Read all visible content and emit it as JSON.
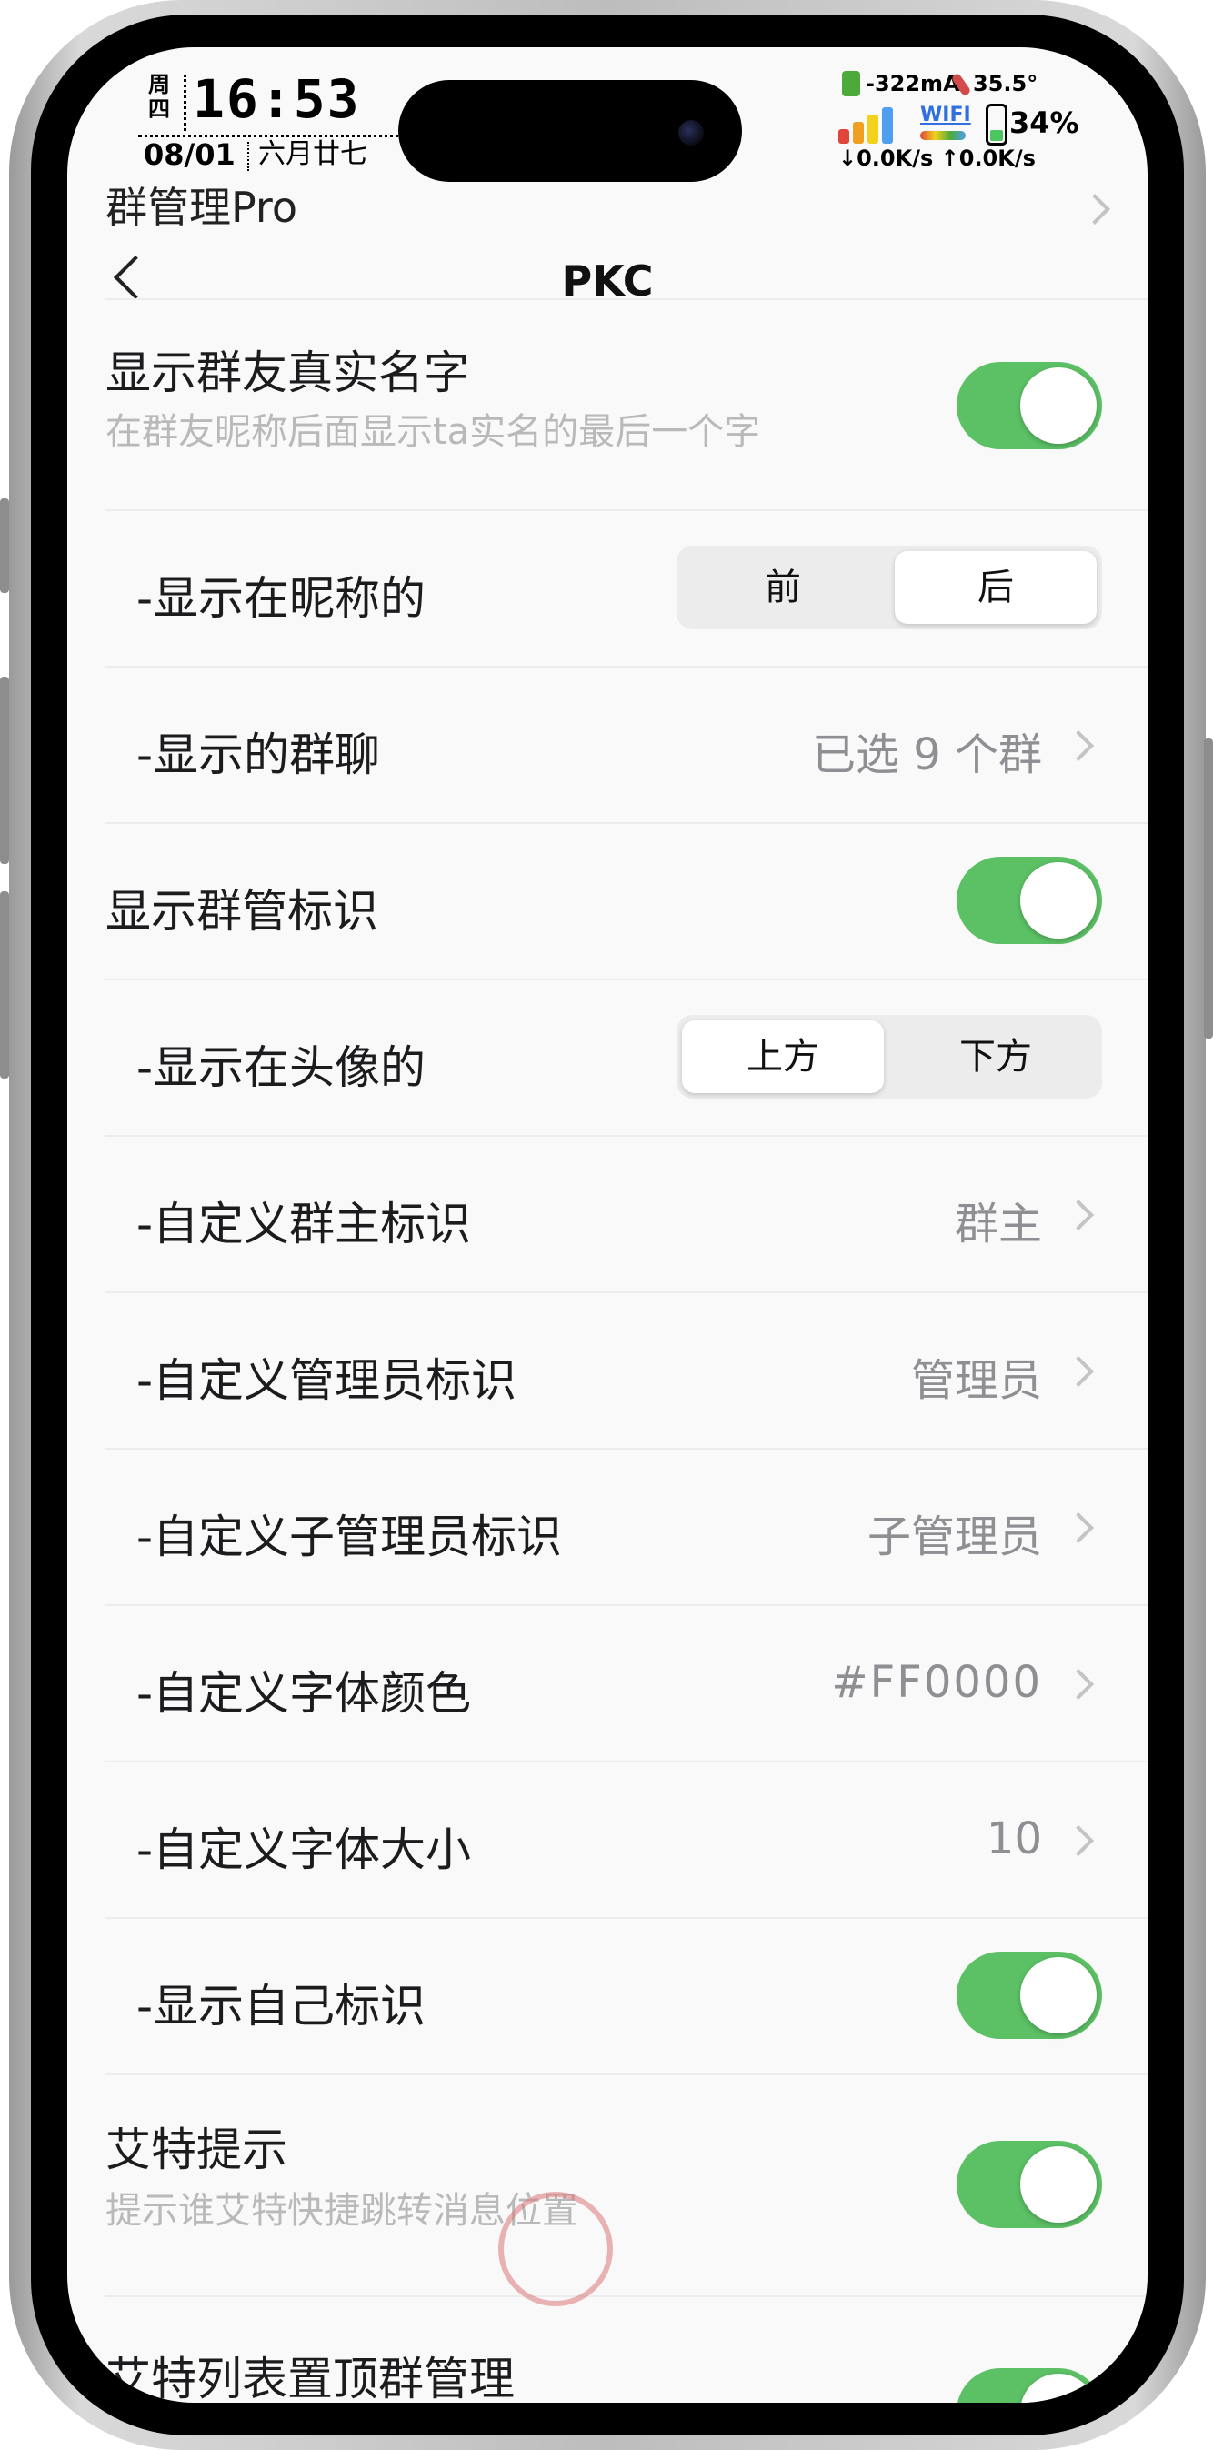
{
  "status_bar": {
    "weekday": "周四",
    "time": "16:53",
    "date": "08/01",
    "lunar_date": "六月廿七",
    "current": "-322mA",
    "temperature": "35.5°",
    "wifi_label": "WIFI",
    "battery": "34%",
    "network_speed": "↓0.0K/s ↑0.0K/s"
  },
  "nav": {
    "partial_title": "群管理Pro",
    "title": "PKC"
  },
  "rows": {
    "show_real_name": {
      "label": "显示群友真实名字",
      "sub": "在群友昵称后面显示ta实名的最后一个字",
      "enabled": true
    },
    "name_position": {
      "label": "-显示在昵称的",
      "options": [
        "前",
        "后"
      ],
      "selected": "后"
    },
    "groups": {
      "label": "-显示的群聊",
      "value": "已选 9 个群"
    },
    "show_admin_badge": {
      "label": "显示群管标识",
      "enabled": true
    },
    "avatar_position": {
      "label": "-显示在头像的",
      "options": [
        "上方",
        "下方"
      ],
      "selected": "上方"
    },
    "owner_badge": {
      "label": "-自定义群主标识",
      "value": "群主"
    },
    "admin_badge": {
      "label": "-自定义管理员标识",
      "value": "管理员"
    },
    "subadmin_badge": {
      "label": "-自定义子管理员标识",
      "value": "子管理员"
    },
    "font_color": {
      "label": "-自定义字体颜色",
      "value": "#FF0000"
    },
    "font_size": {
      "label": "-自定义字体大小",
      "value": "10"
    },
    "show_self_badge": {
      "label": "-显示自己标识",
      "enabled": true
    },
    "at_hint": {
      "label": "艾特提示",
      "sub": "提示谁艾特快捷跳转消息位置",
      "enabled": true
    },
    "at_list_pin": {
      "label": "艾特列表置顶群管理",
      "enabled": true
    }
  },
  "colors": {
    "toggle_on": "#5cc065",
    "background": "#f9f9f9"
  }
}
